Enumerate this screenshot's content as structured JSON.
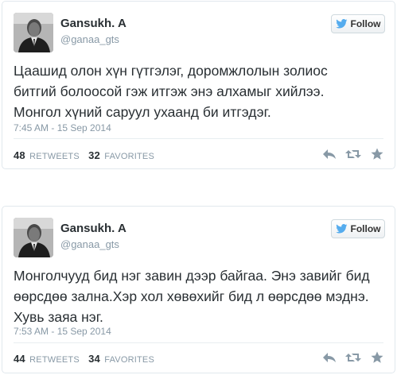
{
  "tweets": [
    {
      "author": {
        "name": "Gansukh. A",
        "handle": "@ganaa_gts"
      },
      "follow_label": "Follow",
      "text": "Цаашид олон хүн гүтгэлэг, доромжлолын золиос\nбитгий болоосой гэж  итгэж энэ алхамыг хийлээ.\nМонгол хүний саруул ухаанд би итгэдэг.",
      "time": "7:45 AM - 15 Sep 2014",
      "retweets": {
        "count": "48",
        "label": "RETWEETS"
      },
      "favorites": {
        "count": "32",
        "label": "FAVORITES"
      }
    },
    {
      "author": {
        "name": "Gansukh. A",
        "handle": "@ganaa_gts"
      },
      "follow_label": "Follow",
      "text": "Монголчууд бид нэг завин дээр байгаа. Энэ завийг бид\nөөрсдөө зална.Хэр хол хөвөхийг бид л өөрсдөө мэднэ.\nХувь заяа нэг.",
      "time": "7:53 AM - 15 Sep 2014",
      "retweets": {
        "count": "44",
        "label": "RETWEETS"
      },
      "favorites": {
        "count": "34",
        "label": "FAVORITES"
      }
    }
  ],
  "icons": {
    "follow": "twitter-bird-icon",
    "reply": "reply-icon",
    "retweet": "retweet-icon",
    "favorite": "star-icon"
  },
  "colors": {
    "twitter_blue": "#55acee",
    "muted_text": "#8899a6",
    "main_text": "#292f33",
    "border": "#e1e8ed"
  }
}
